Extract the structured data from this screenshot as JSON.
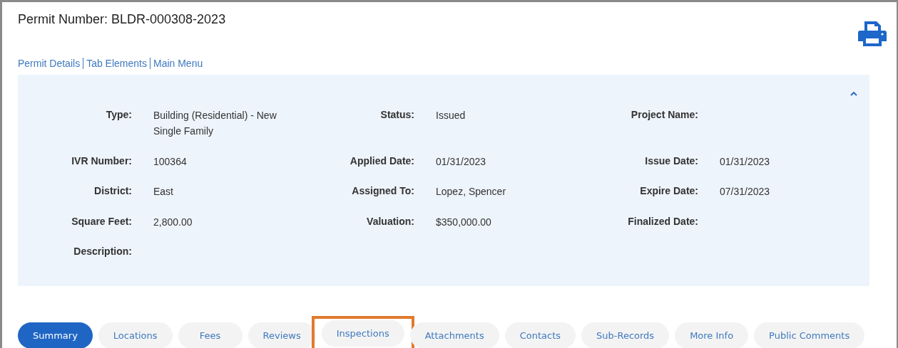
{
  "title": "Permit Number: BLDR-000308-2023",
  "breadcrumbs": [
    "Permit Details",
    "Tab Elements",
    "Main Menu"
  ],
  "details": {
    "expanded": true,
    "rows": [
      [
        {
          "label": "Type:",
          "value": "Building (Residential) - New Single Family"
        },
        {
          "label": "Status:",
          "value": "Issued"
        },
        {
          "label": "Project Name:"
        }
      ],
      [
        {
          "label": "IVR Number:",
          "value": "100364"
        },
        {
          "label": "Applied Date:",
          "value": "01/31/2023"
        },
        {
          "label": "Issue Date:",
          "value": "01/31/2023"
        }
      ],
      [
        {
          "label": "District:",
          "value": "East"
        },
        {
          "label": "Assigned To:",
          "value": "Lopez, Spencer"
        },
        {
          "label": "Expire Date:",
          "value": "07/31/2023"
        }
      ],
      [
        {
          "label": "Square Feet:",
          "value": "2,800.00"
        },
        {
          "label": "Valuation:",
          "value": "$350,000.00"
        },
        {
          "label": "Finalized Date:"
        }
      ],
      [
        {
          "label": "Description:"
        }
      ]
    ]
  },
  "tabs": [
    {
      "label": "Summary",
      "selected": true,
      "highlighted": false
    },
    {
      "label": "Locations",
      "selected": false,
      "highlighted": false
    },
    {
      "label": "Fees",
      "selected": false,
      "highlighted": false
    },
    {
      "label": "Reviews",
      "selected": false,
      "highlighted": false
    },
    {
      "label": "Inspections",
      "selected": false,
      "highlighted": true
    },
    {
      "label": "Attachments",
      "selected": false,
      "highlighted": false
    },
    {
      "label": "Contacts",
      "selected": false,
      "highlighted": false
    },
    {
      "label": "Sub-Records",
      "selected": false,
      "highlighted": false
    },
    {
      "label": "More Info",
      "selected": false,
      "highlighted": false
    },
    {
      "label": "Public Comments",
      "selected": false,
      "highlighted": false
    }
  ]
}
